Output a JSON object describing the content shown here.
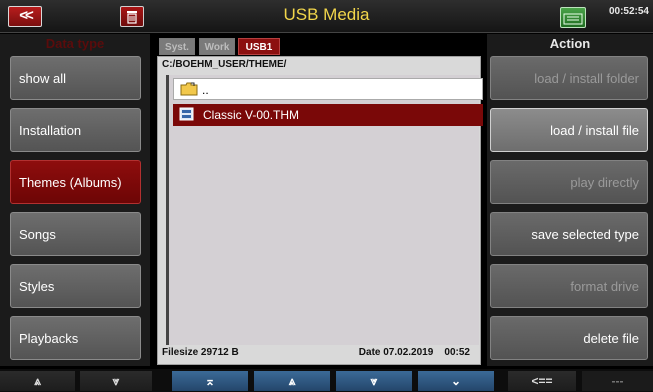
{
  "header": {
    "back_label": "<<",
    "title": "USB Media",
    "clock": "00:52:54",
    "icons": [
      "back-icon",
      "trash-icon",
      "usb-status-icon"
    ]
  },
  "left": {
    "heading": "Data type",
    "items": [
      {
        "label": "show all",
        "active": false
      },
      {
        "label": "Installation",
        "active": false
      },
      {
        "label": "Themes (Albums)",
        "active": true
      },
      {
        "label": "Songs",
        "active": false
      },
      {
        "label": "Styles",
        "active": false
      },
      {
        "label": "Playbacks",
        "active": false
      }
    ]
  },
  "tabs": [
    {
      "label": "Syst.",
      "active": false
    },
    {
      "label": "Work",
      "active": false
    },
    {
      "label": "USB1",
      "active": true
    }
  ],
  "browser": {
    "path": "C:/BOEHM_USER/THEME/",
    "parent": "..",
    "file": "Classic V-00.THM",
    "filesize": "Filesize 29712 B",
    "date": "Date 07.02.2019",
    "time": "00:52"
  },
  "right": {
    "heading": "Action",
    "items": [
      {
        "label": "load  /  install folder",
        "enabled": false
      },
      {
        "label": "load  /  install file",
        "enabled": true
      },
      {
        "label": "play directly",
        "enabled": false
      },
      {
        "label": "save selected type",
        "enabled": true
      },
      {
        "label": "format drive",
        "enabled": false
      },
      {
        "label": "delete file",
        "enabled": true
      }
    ]
  },
  "bottom": {
    "buttons": [
      "⩓",
      "⩔",
      "⌅",
      "⩓",
      "⩔",
      "⌄",
      "<==",
      "---"
    ]
  },
  "colors": {
    "accent_red": "#8c0f0f",
    "title_yellow": "#f2d64b",
    "nav_blue": "#2f5a86"
  }
}
